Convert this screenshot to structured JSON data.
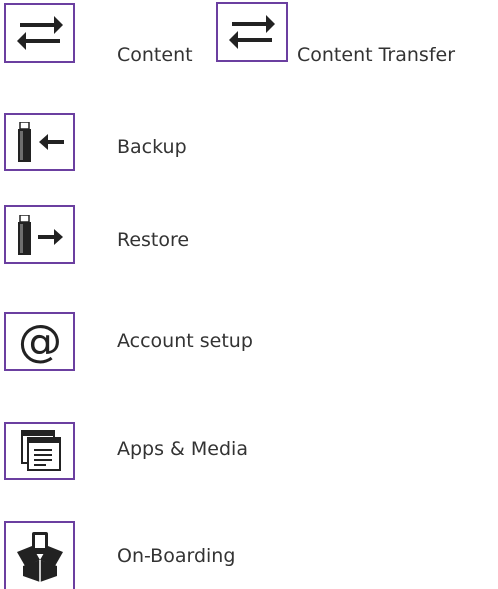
{
  "accent_color": "#6b3fa0",
  "items": [
    {
      "icon": "content-transfer-icon",
      "label": "Content",
      "label2": "Content Transfer"
    },
    {
      "icon": "backup-icon",
      "label": "Backup"
    },
    {
      "icon": "restore-icon",
      "label": "Restore"
    },
    {
      "icon": "account-setup-icon",
      "label": "Account setup"
    },
    {
      "icon": "apps-media-icon",
      "label": "Apps & Media"
    },
    {
      "icon": "onboarding-icon",
      "label": "On-Boarding"
    }
  ]
}
